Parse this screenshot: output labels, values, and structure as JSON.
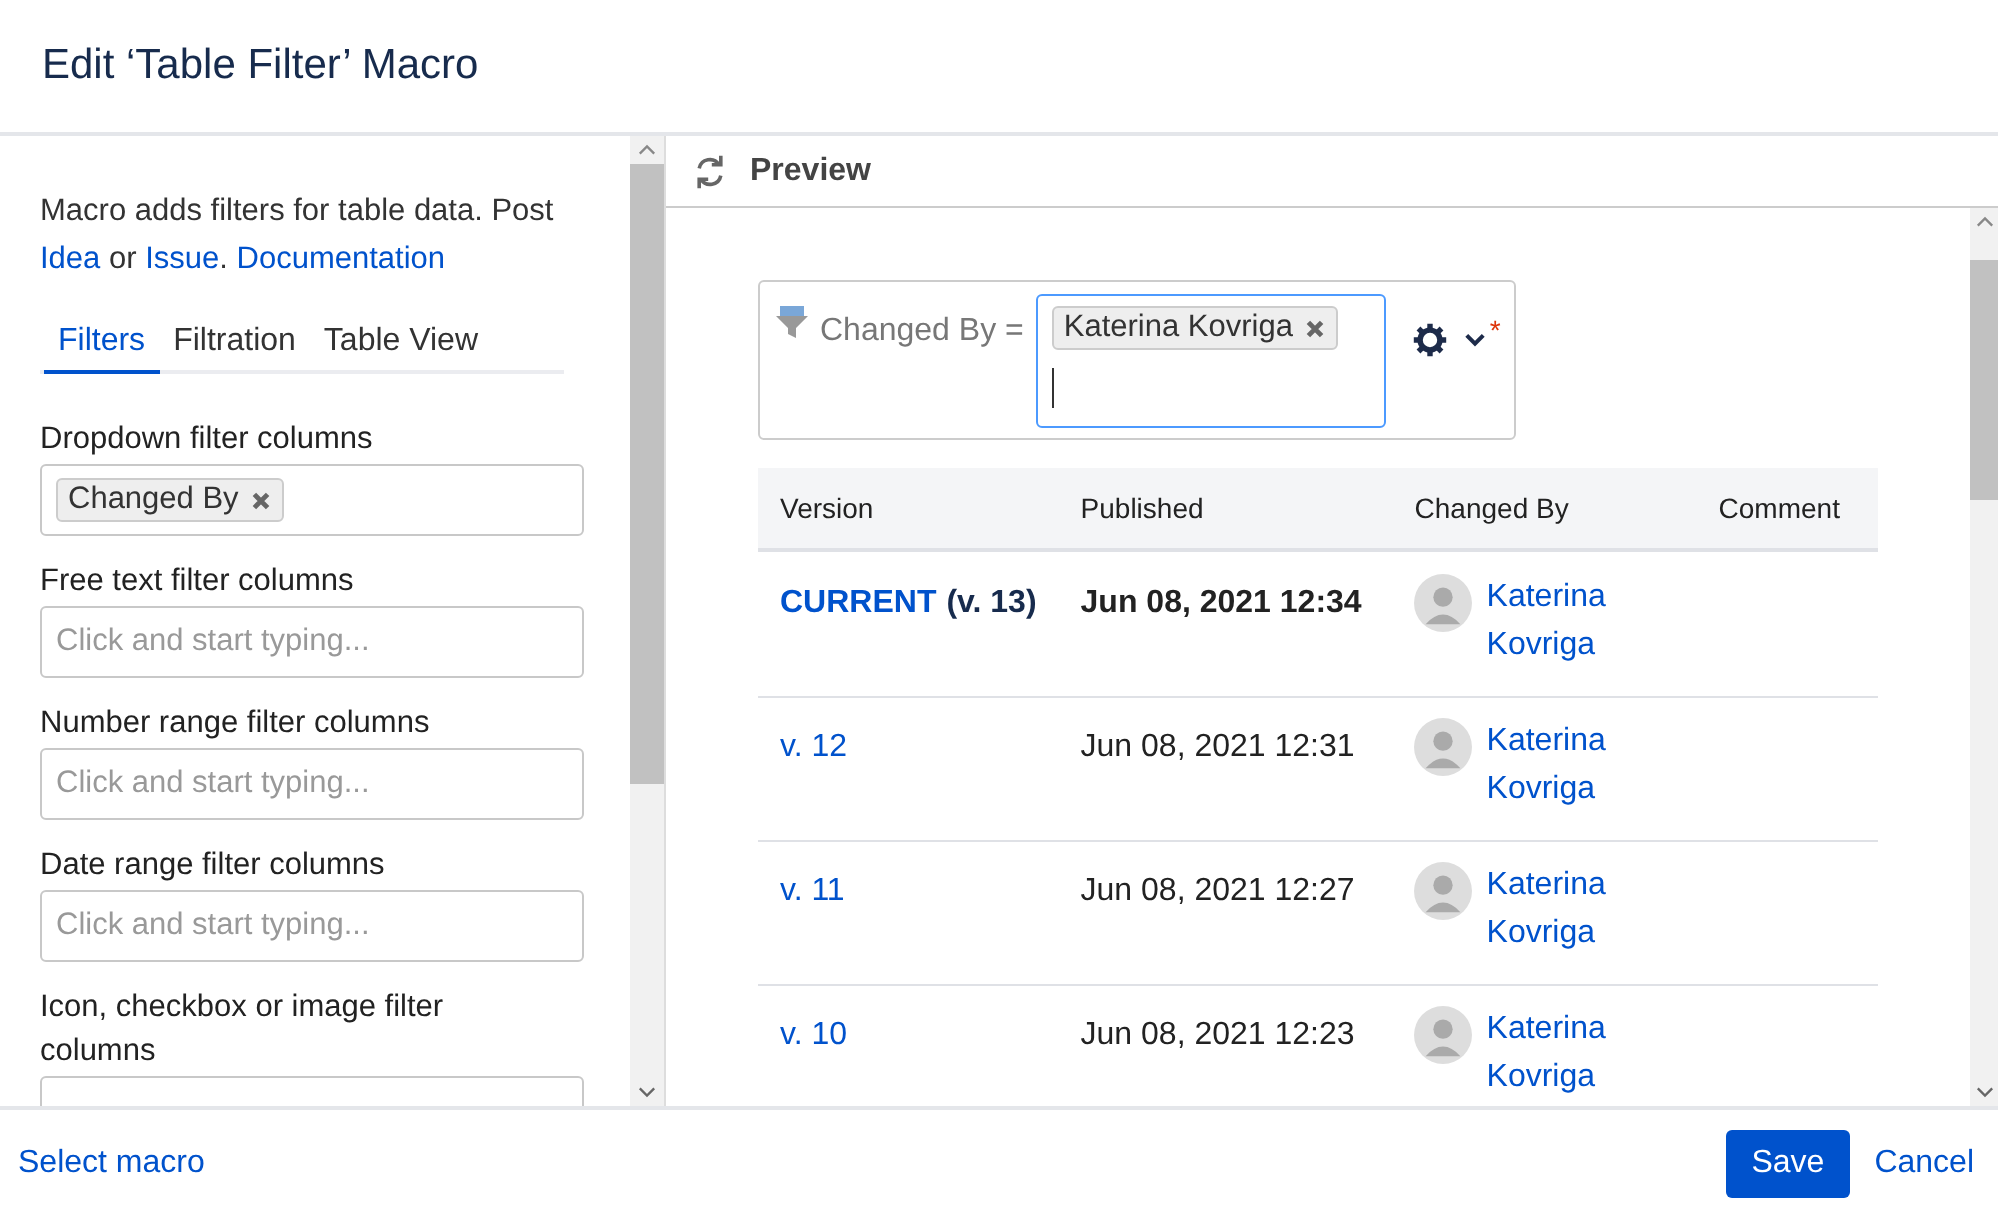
{
  "dialog": {
    "title": "Edit ‘Table Filter’ Macro"
  },
  "sidebar": {
    "description": [
      {
        "kind": "text",
        "text": "Macro adds filters for table data. Post "
      },
      {
        "kind": "link",
        "text": "Idea"
      },
      {
        "kind": "text",
        "text": " or "
      },
      {
        "kind": "link",
        "text": "Issue"
      },
      {
        "kind": "text",
        "text": ". "
      },
      {
        "kind": "link",
        "text": "Documentation"
      }
    ],
    "tabs": [
      {
        "label": "Filters",
        "selected": true
      },
      {
        "label": "Filtration",
        "selected": false
      },
      {
        "label": "Table View",
        "selected": false
      }
    ],
    "fields": [
      {
        "label": "Dropdown filter columns",
        "tags": [
          "Changed By"
        ]
      },
      {
        "label": "Free text filter columns",
        "placeholder": "Click and start typing..."
      },
      {
        "label": "Number range filter columns",
        "placeholder": "Click and start typing..."
      },
      {
        "label": "Date range filter columns",
        "placeholder": "Click and start typing..."
      },
      {
        "label": "Icon, checkbox or image filter columns"
      }
    ]
  },
  "preview": {
    "title": "Preview",
    "filter": {
      "label": "Changed By =",
      "tags": [
        "Katerina Kovriga"
      ],
      "focused": true,
      "required_mark": "*"
    },
    "table": {
      "columns": [
        "Version",
        "Published",
        "Changed By",
        "Comment"
      ],
      "rows": [
        {
          "version": "CURRENT",
          "suffix": "(v. 13)",
          "current": true,
          "published": "Jun 08, 2021 12:34",
          "changed_by": "Katerina Kovriga"
        },
        {
          "version": "v. 12",
          "current": false,
          "published": "Jun 08, 2021 12:31",
          "changed_by": "Katerina Kovriga"
        },
        {
          "version": "v. 11",
          "current": false,
          "published": "Jun 08, 2021 12:27",
          "changed_by": "Katerina Kovriga"
        },
        {
          "version": "v. 10",
          "current": false,
          "published": "Jun 08, 2021 12:23",
          "changed_by": "Katerina Kovriga"
        }
      ]
    }
  },
  "footer": {
    "link": "Select macro",
    "buttons": [
      {
        "label": "Save",
        "kind": "primary"
      },
      {
        "label": "Cancel",
        "kind": "link"
      }
    ]
  }
}
